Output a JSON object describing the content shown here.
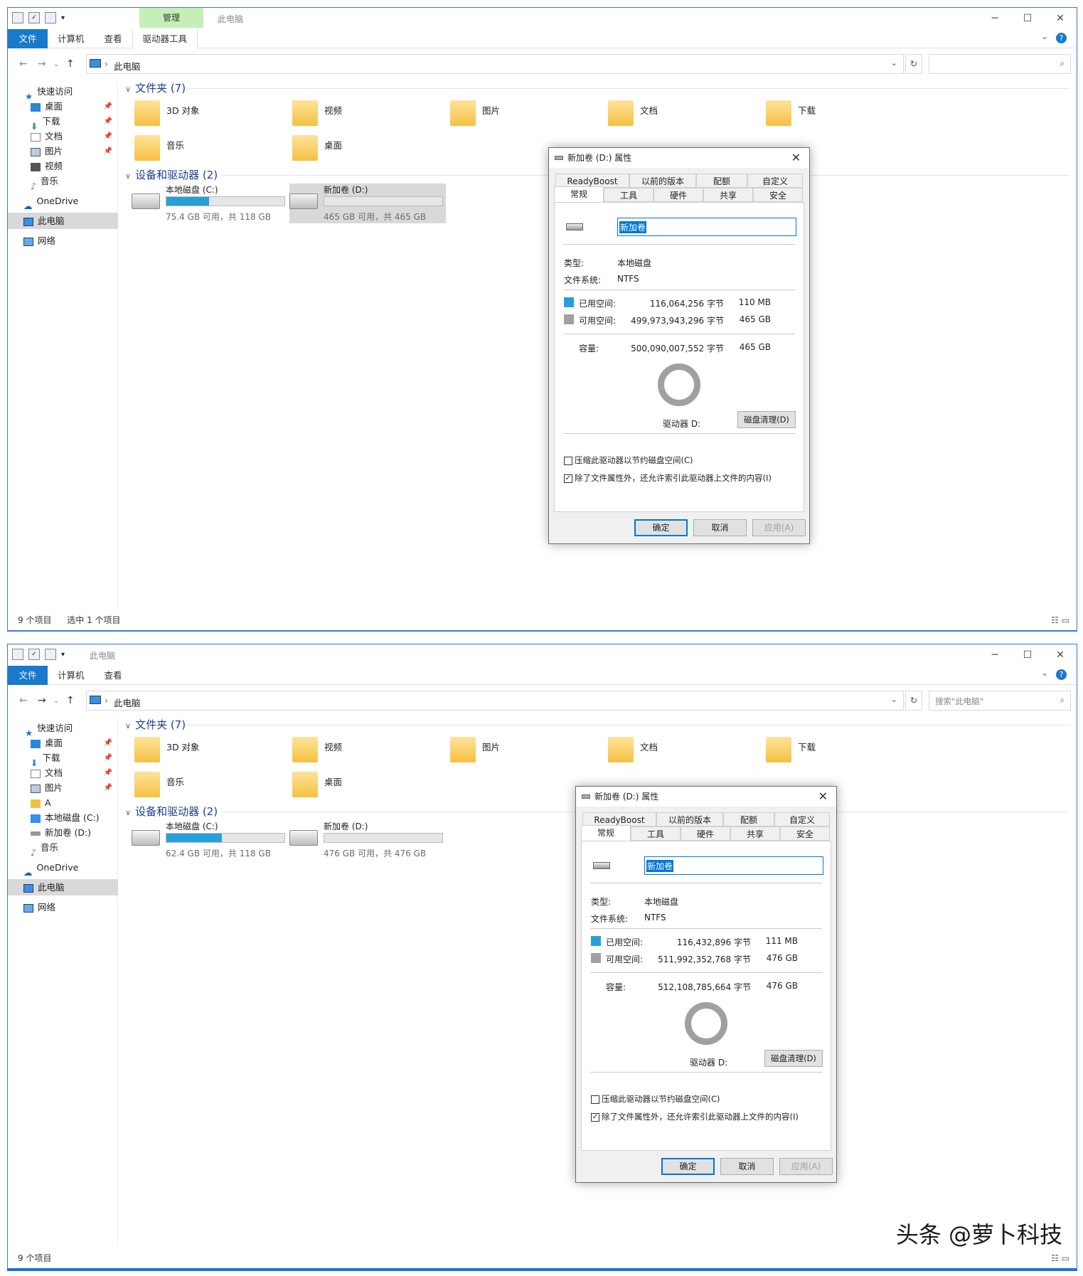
{
  "w1": {
    "ctx_tab": "管理",
    "title": "此电脑",
    "tabs": {
      "file": "文件",
      "computer": "计算机",
      "view": "查看",
      "drive_tools": "驱动器工具"
    },
    "path": "此电脑",
    "search_placeholder": "",
    "nav": {
      "quick": "快速访问",
      "desktop": "桌面",
      "downloads": "下载",
      "docs": "文档",
      "pictures": "图片",
      "videos": "视频",
      "music": "音乐",
      "onedrive": "OneDrive",
      "pc": "此电脑",
      "network": "网络"
    },
    "folders_header": "文件夹 (7)",
    "folders": [
      "3D 对象",
      "视频",
      "图片",
      "文档",
      "下载",
      "音乐",
      "桌面"
    ],
    "drives_header": "设备和驱动器 (2)",
    "drive_c": {
      "name": "本地磁盘 (C:)",
      "space": "75.4 GB 可用，共 118 GB",
      "used_fraction": 0.36
    },
    "drive_d": {
      "name": "新加卷 (D:)",
      "space": "465 GB 可用，共 465 GB",
      "used_fraction": 0.0
    },
    "status": {
      "count": "9 个项目",
      "selected": "选中 1 个项目"
    },
    "dialog": {
      "title": "新加卷 (D:) 属性",
      "tabs_top": [
        "ReadyBoost",
        "以前的版本",
        "配额",
        "自定义"
      ],
      "tabs_bottom": [
        "常规",
        "工具",
        "硬件",
        "共享",
        "安全"
      ],
      "name": "新加卷",
      "type_label": "类型:",
      "type": "本地磁盘",
      "fs_label": "文件系统:",
      "fs": "NTFS",
      "used_label": "已用空间:",
      "used_bytes": "116,064,256 字节",
      "used_size": "110 MB",
      "free_label": "可用空间:",
      "free_bytes": "499,973,943,296 字节",
      "free_size": "465 GB",
      "cap_label": "容量:",
      "cap_bytes": "500,090,007,552 字节",
      "cap_size": "465 GB",
      "drive_label": "驱动器 D:",
      "cleanup": "磁盘清理(D)",
      "compress": "压缩此驱动器以节约磁盘空间(C)",
      "index": "除了文件属性外，还允许索引此驱动器上文件的内容(I)",
      "ok": "确定",
      "cancel": "取消",
      "apply": "应用(A)"
    }
  },
  "w2": {
    "title": "此电脑",
    "tabs": {
      "file": "文件",
      "computer": "计算机",
      "view": "查看"
    },
    "path": "此电脑",
    "search_placeholder": "搜索\"此电脑\"",
    "nav": {
      "quick": "快速访问",
      "desktop": "桌面",
      "downloads": "下载",
      "docs": "文档",
      "pictures": "图片",
      "a": "A",
      "local_c": "本地磁盘 (C:)",
      "new_d": "新加卷 (D:)",
      "music": "音乐",
      "onedrive": "OneDrive",
      "pc": "此电脑",
      "network": "网络"
    },
    "folders_header": "文件夹 (7)",
    "folders": [
      "3D 对象",
      "视频",
      "图片",
      "文档",
      "下载",
      "音乐",
      "桌面"
    ],
    "drives_header": "设备和驱动器 (2)",
    "drive_c": {
      "name": "本地磁盘 (C:)",
      "space": "62.4 GB 可用，共 118 GB",
      "used_fraction": 0.47
    },
    "drive_d": {
      "name": "新加卷 (D:)",
      "space": "476 GB 可用，共 476 GB",
      "used_fraction": 0.0
    },
    "status": {
      "count": "9 个项目"
    },
    "dialog": {
      "title": "新加卷 (D:) 属性",
      "tabs_top": [
        "ReadyBoost",
        "以前的版本",
        "配额",
        "自定义"
      ],
      "tabs_bottom": [
        "常规",
        "工具",
        "硬件",
        "共享",
        "安全"
      ],
      "name": "新加卷",
      "type_label": "类型:",
      "type": "本地磁盘",
      "fs_label": "文件系统:",
      "fs": "NTFS",
      "used_label": "已用空间:",
      "used_bytes": "116,432,896 字节",
      "used_size": "111 MB",
      "free_label": "可用空间:",
      "free_bytes": "511,992,352,768 字节",
      "free_size": "476 GB",
      "cap_label": "容量:",
      "cap_bytes": "512,108,785,664 字节",
      "cap_size": "476 GB",
      "drive_label": "驱动器 D:",
      "cleanup": "磁盘清理(D)",
      "compress": "压缩此驱动器以节约磁盘空间(C)",
      "index": "除了文件属性外，还允许索引此驱动器上文件的内容(I)",
      "ok": "确定",
      "cancel": "取消",
      "apply": "应用(A)"
    }
  },
  "colors": {
    "used": "#26a0da",
    "free": "#a0a0a0",
    "accent": "#1979ca"
  },
  "watermark": "头条 @萝卜科技"
}
